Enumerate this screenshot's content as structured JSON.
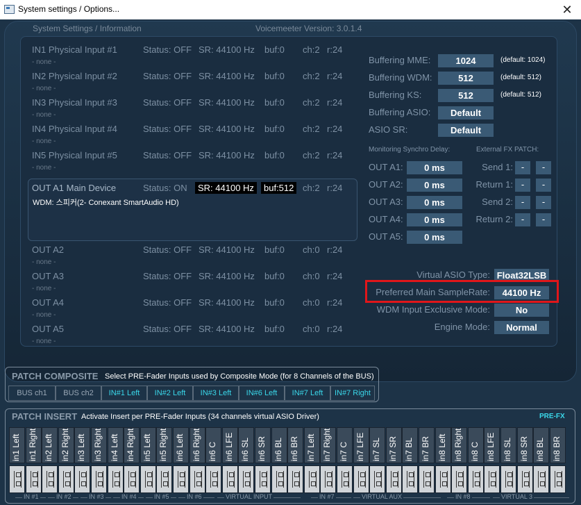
{
  "window": {
    "title": "System settings / Options...",
    "close": "✕"
  },
  "header": {
    "section": "System Settings / Information",
    "version": "Voicemeeter Version: 3.0.1.4"
  },
  "inputs": [
    {
      "name": "IN1 Physical Input #1",
      "status": "Status: OFF",
      "sr": "SR: 44100 Hz",
      "buf": "buf:0",
      "ch": "ch:2",
      "r": "r:24",
      "device": "- none -"
    },
    {
      "name": "IN2 Physical Input #2",
      "status": "Status: OFF",
      "sr": "SR: 44100 Hz",
      "buf": "buf:0",
      "ch": "ch:2",
      "r": "r:24",
      "device": "- none -"
    },
    {
      "name": "IN3 Physical Input #3",
      "status": "Status: OFF",
      "sr": "SR: 44100 Hz",
      "buf": "buf:0",
      "ch": "ch:2",
      "r": "r:24",
      "device": "- none -"
    },
    {
      "name": "IN4 Physical Input #4",
      "status": "Status: OFF",
      "sr": "SR: 44100 Hz",
      "buf": "buf:0",
      "ch": "ch:2",
      "r": "r:24",
      "device": "- none -"
    },
    {
      "name": "IN5 Physical Input #5",
      "status": "Status: OFF",
      "sr": "SR: 44100 Hz",
      "buf": "buf:0",
      "ch": "ch:2",
      "r": "r:24",
      "device": "- none -"
    }
  ],
  "out_a1": {
    "name": "OUT A1 Main Device",
    "status": "Status: ON",
    "sr": "SR: 44100 Hz",
    "buf": "buf:512",
    "ch": "ch:2",
    "r": "r:24",
    "device": "WDM: 스피커(2- Conexant SmartAudio HD)"
  },
  "outputs": [
    {
      "name": "OUT A2",
      "status": "Status: OFF",
      "sr": "SR: 44100 Hz",
      "buf": "buf:0",
      "ch": "ch:0",
      "r": "r:24",
      "device": "- none -"
    },
    {
      "name": "OUT A3",
      "status": "Status: OFF",
      "sr": "SR: 44100 Hz",
      "buf": "buf:0",
      "ch": "ch:0",
      "r": "r:24",
      "device": "- none -"
    },
    {
      "name": "OUT A4",
      "status": "Status: OFF",
      "sr": "SR: 44100 Hz",
      "buf": "buf:0",
      "ch": "ch:0",
      "r": "r:24",
      "device": "- none -"
    },
    {
      "name": "OUT A5",
      "status": "Status: OFF",
      "sr": "SR: 44100 Hz",
      "buf": "buf:0",
      "ch": "ch:0",
      "r": "r:24",
      "device": "- none -"
    }
  ],
  "buffering": [
    {
      "label": "Buffering MME:",
      "value": "1024",
      "default": "(default: 1024)"
    },
    {
      "label": "Buffering WDM:",
      "value": "512",
      "default": "(default: 512)"
    },
    {
      "label": "Buffering KS:",
      "value": "512",
      "default": "(default: 512)"
    },
    {
      "label": "Buffering ASIO:",
      "value": "Default",
      "default": ""
    },
    {
      "label": "ASIO SR:",
      "value": "Default",
      "default": ""
    }
  ],
  "monitoring": {
    "title": "Monitoring Synchro Delay:",
    "rows": [
      {
        "label": "OUT A1:",
        "value": "0 ms"
      },
      {
        "label": "OUT A2:",
        "value": "0 ms"
      },
      {
        "label": "OUT A3:",
        "value": "0 ms"
      },
      {
        "label": "OUT A4:",
        "value": "0 ms"
      },
      {
        "label": "OUT A5:",
        "value": "0 ms"
      }
    ]
  },
  "fx_patch": {
    "title": "External FX PATCH:",
    "rows": [
      {
        "label": "Send 1:",
        "a": "-",
        "b": "-"
      },
      {
        "label": "Return 1:",
        "a": "-",
        "b": "-"
      },
      {
        "label": "Send 2:",
        "a": "-",
        "b": "-"
      },
      {
        "label": "Return 2:",
        "a": "-",
        "b": "-"
      }
    ]
  },
  "settings": [
    {
      "label": "Virtual ASIO Type:",
      "value": "Float32LSB"
    },
    {
      "label": "Preferred Main SampleRate:",
      "value": "44100 Hz"
    },
    {
      "label": "WDM Input Exclusive Mode:",
      "value": "No"
    },
    {
      "label": "Engine Mode:",
      "value": "Normal"
    }
  ],
  "composite": {
    "title": "PATCH COMPOSITE",
    "desc": "Select PRE-Fader Inputs used by Composite Mode (for 8 Channels of the BUS)",
    "buttons": [
      "BUS ch1",
      "BUS ch2",
      "IN#1 Left",
      "IN#2 Left",
      "IN#3 Left",
      "IN#6 Left",
      "IN#7 Left",
      "IN#7 Right"
    ]
  },
  "insert": {
    "title": "PATCH INSERT",
    "desc": "Activate Insert per PRE-Fader Inputs (34 channels virtual ASIO Driver)",
    "prefx": "PRE-FX",
    "channels": [
      "in1 Left",
      "in1 Right",
      "in2 Left",
      "in2 Right",
      "in3 Left",
      "in3 Right",
      "in4 Left",
      "in4 Right",
      "in5 Left",
      "in5 Right",
      "in6 Left",
      "in6 Right",
      "in6 C",
      "in6 LFE",
      "in6 SL",
      "in6 SR",
      "in6 BL",
      "in6 BR",
      "in7 Left",
      "in7 Right",
      "in7 C",
      "in7 LFE",
      "in7 SL",
      "in7 SR",
      "in7 BL",
      "in7 BR",
      "in8 Left",
      "in8 Right",
      "in8 C",
      "in8 LFE",
      "in8 SL",
      "in8 SR",
      "in8 BL",
      "in8 BR"
    ],
    "groups": [
      "IN #1",
      "IN #2",
      "IN #3",
      "IN #4",
      "IN #5",
      "IN #6",
      "VIRTUAL INPUT",
      "IN #7",
      "VIRTUAL AUX",
      "IN #8",
      "VIRTUAL 3"
    ]
  }
}
